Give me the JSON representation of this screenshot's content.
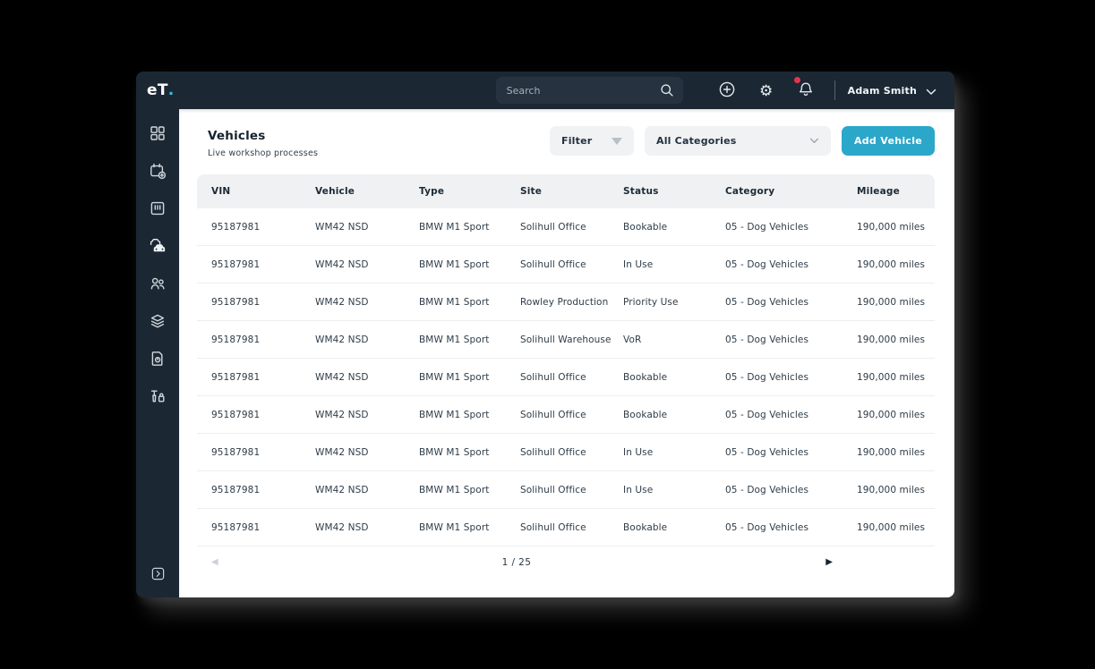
{
  "app": {
    "logo_text": "eT",
    "logo_dot": "."
  },
  "navbar": {
    "search_placeholder": "Search",
    "user_name": "Adam Smith",
    "icons": [
      "search-icon",
      "plus-circle-icon",
      "gear-icon",
      "notifications-bell-icon",
      "chevron-down-icon"
    ],
    "gear_glyph": "⚙",
    "has_notification": true
  },
  "sidebar": {
    "items": [
      "dashboard",
      "calendar-add",
      "board",
      "vehicles",
      "users",
      "layers",
      "reports",
      "tools"
    ],
    "active_item": "vehicles",
    "collapse": "collapse-sidebar"
  },
  "page": {
    "title": "Vehicles",
    "subtitle": "Live workshop processes"
  },
  "toolbar": {
    "filter_label": "Filter",
    "categories_value": "All Categories",
    "add_button_label": "Add Vehicle"
  },
  "table": {
    "columns": [
      "VIN",
      "Vehicle",
      "Type",
      "Site",
      "Status",
      "Category",
      "Mileage"
    ],
    "rows": [
      [
        "95187981",
        "WM42 NSD",
        "BMW M1 Sport",
        "Solihull Office",
        "Bookable",
        "05 - Dog Vehicles",
        "190,000 miles"
      ],
      [
        "95187981",
        "WM42 NSD",
        "BMW M1 Sport",
        "Solihull Office",
        "In Use",
        "05 - Dog Vehicles",
        "190,000 miles"
      ],
      [
        "95187981",
        "WM42 NSD",
        "BMW M1 Sport",
        "Rowley Production",
        "Priority Use",
        "05 - Dog Vehicles",
        "190,000 miles"
      ],
      [
        "95187981",
        "WM42 NSD",
        "BMW M1 Sport",
        "Solihull Warehouse",
        "VoR",
        "05 - Dog Vehicles",
        "190,000 miles"
      ],
      [
        "95187981",
        "WM42 NSD",
        "BMW M1 Sport",
        "Solihull Office",
        "Bookable",
        "05 - Dog Vehicles",
        "190,000 miles"
      ],
      [
        "95187981",
        "WM42 NSD",
        "BMW M1 Sport",
        "Solihull Office",
        "Bookable",
        "05 - Dog Vehicles",
        "190,000 miles"
      ],
      [
        "95187981",
        "WM42 NSD",
        "BMW M1 Sport",
        "Solihull Office",
        "In Use",
        "05 - Dog Vehicles",
        "190,000 miles"
      ],
      [
        "95187981",
        "WM42 NSD",
        "BMW M1 Sport",
        "Solihull Office",
        "In Use",
        "05 - Dog Vehicles",
        "190,000 miles"
      ],
      [
        "95187981",
        "WM42 NSD",
        "BMW M1 Sport",
        "Solihull Office",
        "Bookable",
        "05 - Dog Vehicles",
        "190,000 miles"
      ]
    ]
  },
  "pagination": {
    "display": "1 / 25",
    "prev_glyph": "◀",
    "next_glyph": "▶"
  },
  "colors": {
    "chrome": "#1b2733",
    "accent": "#2ba7c9",
    "logo-dot": "#3fc0e0",
    "alert": "#e6344e"
  }
}
